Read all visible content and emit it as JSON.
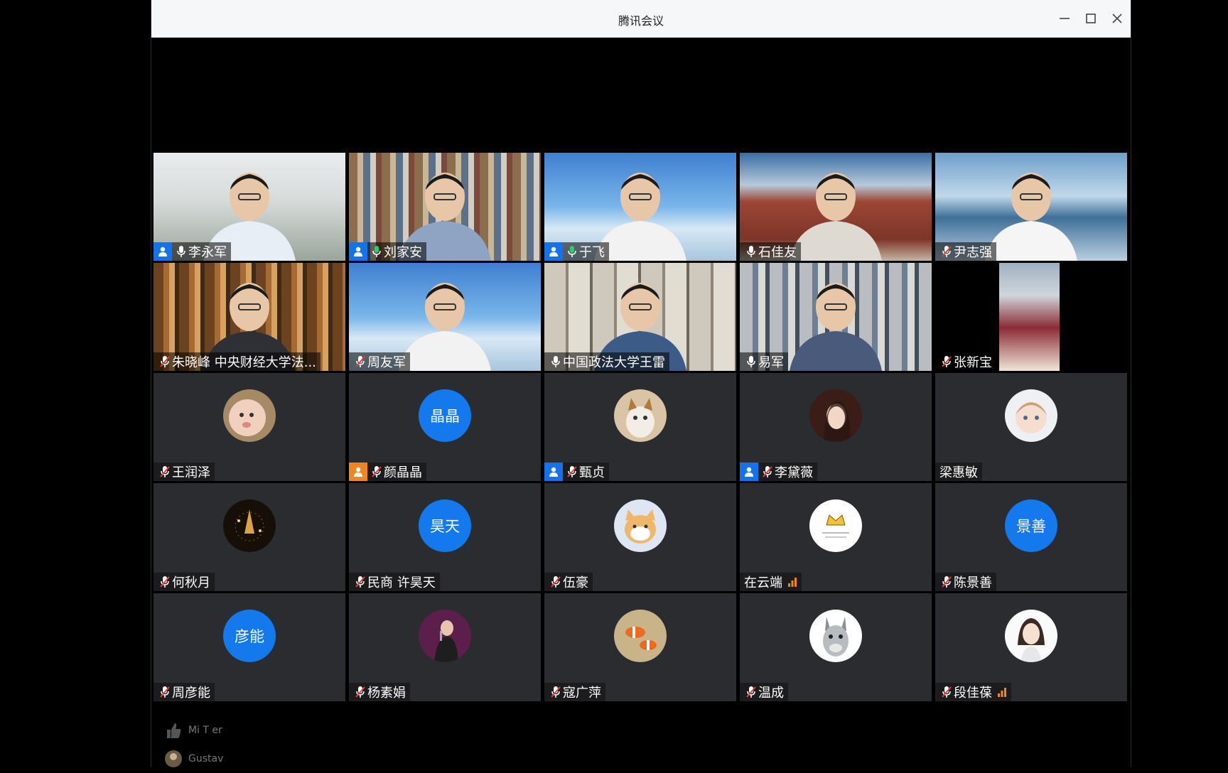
{
  "window": {
    "title": "腾讯会议"
  },
  "participants": [
    {
      "name": "李永军",
      "type": "video",
      "bg": "garden",
      "host": true,
      "mic": "on"
    },
    {
      "name": "刘家安",
      "type": "video",
      "bg": "books",
      "host": true,
      "mic": "speaking"
    },
    {
      "name": "于飞",
      "type": "video",
      "bg": "sky",
      "host": true,
      "mic": "speaking",
      "active": true
    },
    {
      "name": "石佳友",
      "type": "video",
      "bg": "campus",
      "host": false,
      "mic": "on"
    },
    {
      "name": "尹志强",
      "type": "video",
      "bg": "sky2",
      "host": false,
      "mic": "muted"
    },
    {
      "name": "朱晓峰 中央财经大学法...",
      "type": "video",
      "bg": "shelf",
      "host": false,
      "mic": "muted"
    },
    {
      "name": "周友军",
      "type": "video",
      "bg": "sky",
      "host": false,
      "mic": "muted"
    },
    {
      "name": "中国政法大学王雷",
      "type": "video",
      "bg": "cabinet",
      "host": false,
      "mic": "on"
    },
    {
      "name": "易军",
      "type": "video",
      "bg": "books2",
      "host": false,
      "mic": "on"
    },
    {
      "name": "张新宝",
      "type": "video",
      "bg": "portrait",
      "host": false,
      "mic": "muted"
    },
    {
      "name": "王润泽",
      "type": "avatar",
      "avatar": "baby",
      "host": false,
      "mic": "muted"
    },
    {
      "name": "颜晶晶",
      "type": "avatar",
      "avatar_text": "晶晶",
      "host": true,
      "host_color": "orange",
      "mic": "muted"
    },
    {
      "name": "甄贞",
      "type": "avatar",
      "avatar": "cat",
      "host": true,
      "mic": "muted"
    },
    {
      "name": "李黛薇",
      "type": "avatar",
      "avatar": "woman",
      "host": true,
      "mic": "muted"
    },
    {
      "name": "梁惠敏",
      "type": "avatar",
      "avatar": "child",
      "host": false,
      "mic": "none"
    },
    {
      "name": "何秋月",
      "type": "avatar",
      "avatar": "sparkle",
      "host": false,
      "mic": "muted"
    },
    {
      "name": "民商 许昊天",
      "type": "avatar",
      "avatar_text": "昊天",
      "host": false,
      "mic": "muted"
    },
    {
      "name": "伍豪",
      "type": "avatar",
      "avatar": "dog",
      "host": false,
      "mic": "muted"
    },
    {
      "name": "在云端",
      "type": "avatar",
      "avatar": "crown",
      "host": false,
      "mic": "none",
      "signal": true
    },
    {
      "name": "陈景善",
      "type": "avatar",
      "avatar_text": "景善",
      "host": false,
      "mic": "muted"
    },
    {
      "name": "周彦能",
      "type": "avatar",
      "avatar_text": "彦能",
      "host": false,
      "mic": "muted"
    },
    {
      "name": "杨素娟",
      "type": "avatar",
      "avatar": "singer",
      "host": false,
      "mic": "muted"
    },
    {
      "name": "寇广萍",
      "type": "avatar",
      "avatar": "fish",
      "host": false,
      "mic": "muted"
    },
    {
      "name": "温成",
      "type": "avatar",
      "avatar": "donkey",
      "host": false,
      "mic": "muted"
    },
    {
      "name": "段佳葆",
      "type": "avatar",
      "avatar": "girl",
      "host": false,
      "mic": "muted",
      "signal": true
    }
  ],
  "chat": [
    {
      "text": "Mi T er",
      "icon": "thumbs-up-icon"
    },
    {
      "text": "Gustav",
      "icon": "avatar-icon"
    }
  ],
  "colors": {
    "host_badge": "#1273eb",
    "host_badge_alt": "#f08524",
    "avatar_blue": "#1479ec",
    "muted_red": "#e0413b",
    "speaking_green": "#2ecc71",
    "tile_bg": "#2b2c30"
  }
}
